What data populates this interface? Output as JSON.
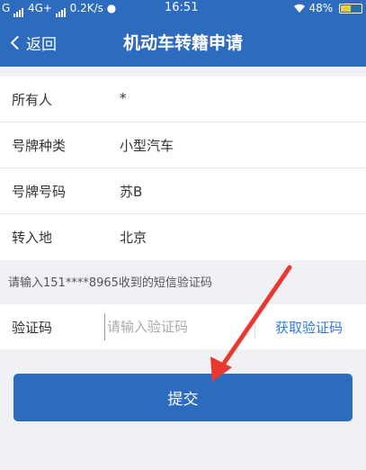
{
  "status_bar": {
    "network": "G",
    "network2": "4G+",
    "speed": "0.2K/s",
    "time": "16:51",
    "battery_pct": "48%",
    "battery_level": 0.48
  },
  "nav": {
    "back_label": "返回",
    "title": "机动车转籍申请"
  },
  "form": {
    "rows": [
      {
        "label": "所有人",
        "value": "*"
      },
      {
        "label": "号牌种类",
        "value": "小型汽车"
      },
      {
        "label": "号牌号码",
        "value": "苏B"
      },
      {
        "label": "转入地",
        "value": "北京"
      }
    ]
  },
  "sms_hint": "请输入151****8965收到的短信验证码",
  "code": {
    "label": "验证码",
    "placeholder": "请输入验证码",
    "get_code_label": "获取验证码"
  },
  "submit_label": "提交",
  "colors": {
    "primary": "#2d6bbf",
    "link": "#2d7bd8",
    "annotation_arrow": "#e8382f"
  }
}
